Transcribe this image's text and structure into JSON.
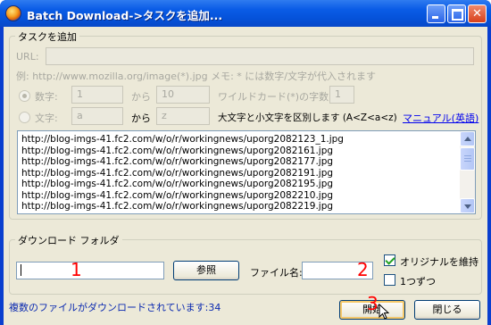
{
  "window": {
    "title": "Batch Download->タスクを追加..."
  },
  "task_group": {
    "legend": "タスクを追加",
    "url_label": "URL:",
    "url_value": "",
    "example_text": "例: http://www.mozilla.org/image(*).jpg メモ: * には数字/文字が代入されます",
    "number_option": {
      "label": "数字:",
      "from": "1",
      "kara": "から",
      "to": "10",
      "wildcard_label": "ワイルドカード(*)の字数:",
      "wildcard_digits": "1"
    },
    "letter_option": {
      "label": "文字:",
      "from": "a",
      "kara": "から",
      "to": "z",
      "case_note": "大文字と小文字を区別します (A<Z<a<z)",
      "manual_link": "マニュアル(英語)"
    },
    "file_list": [
      "http://blog-imgs-41.fc2.com/w/o/r/workingnews/uporg2082123_1.jpg",
      "http://blog-imgs-41.fc2.com/w/o/r/workingnews/uporg2082161.jpg",
      "http://blog-imgs-41.fc2.com/w/o/r/workingnews/uporg2082177.jpg",
      "http://blog-imgs-41.fc2.com/w/o/r/workingnews/uporg2082191.jpg",
      "http://blog-imgs-41.fc2.com/w/o/r/workingnews/uporg2082195.jpg",
      "http://blog-imgs-41.fc2.com/w/o/r/workingnews/uporg2082210.jpg",
      "http://blog-imgs-41.fc2.com/w/o/r/workingnews/uporg2082219.jpg"
    ]
  },
  "download_group": {
    "legend": "ダウンロード フォルダ",
    "folder_value": "",
    "browse_label": "参照",
    "filename_label": "ファイル名:",
    "filename_value": "",
    "keep_original_label": "オリジナルを維持",
    "one_by_one_label": "1つずつ",
    "annotations": [
      "1",
      "2",
      "3"
    ]
  },
  "status_text": "複数のファイルがダウンロードされています:34",
  "buttons": {
    "start_label": "開始",
    "close_label": "閉じる"
  },
  "colors": {
    "title_bar": "#0552d9",
    "client_bg": "#ece9d8",
    "status_text": "#0a29b0",
    "annotation": "#ff0000",
    "link": "#0000ee"
  },
  "icons": [
    "firefox-icon",
    "minimize-icon",
    "maximize-icon",
    "close-icon",
    "scroll-up-icon",
    "scroll-down-icon",
    "mouse-cursor-icon"
  ]
}
